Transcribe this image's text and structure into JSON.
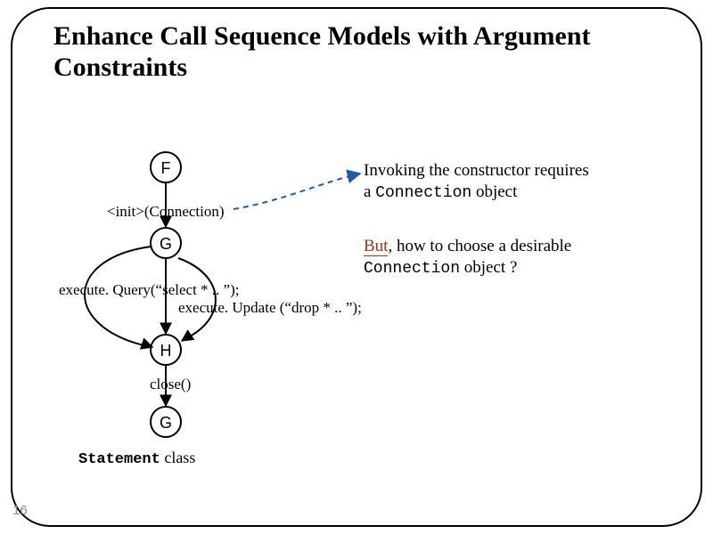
{
  "slide": {
    "number": "16",
    "title": "Enhance Call Sequence Models with Argument Constraints"
  },
  "nodes": {
    "F": "F",
    "G1": "G",
    "H": "H",
    "G2": "G"
  },
  "edges": {
    "init": "<init>(Connection)",
    "query": "execute. Query(“select * .. ”);",
    "update": "execute. Update (“drop * .. ”);",
    "close": "close()"
  },
  "class_label": {
    "prefix": "Statement",
    "suffix": " class"
  },
  "annotations": {
    "top1": "Invoking the constructor requires",
    "top2a": "a ",
    "top2b": "Connection",
    "top2c": " object",
    "bot1a": "But",
    "bot1b": ", how to choose a desirable",
    "bot2a": "Connection",
    "bot2b": "  object ?"
  }
}
